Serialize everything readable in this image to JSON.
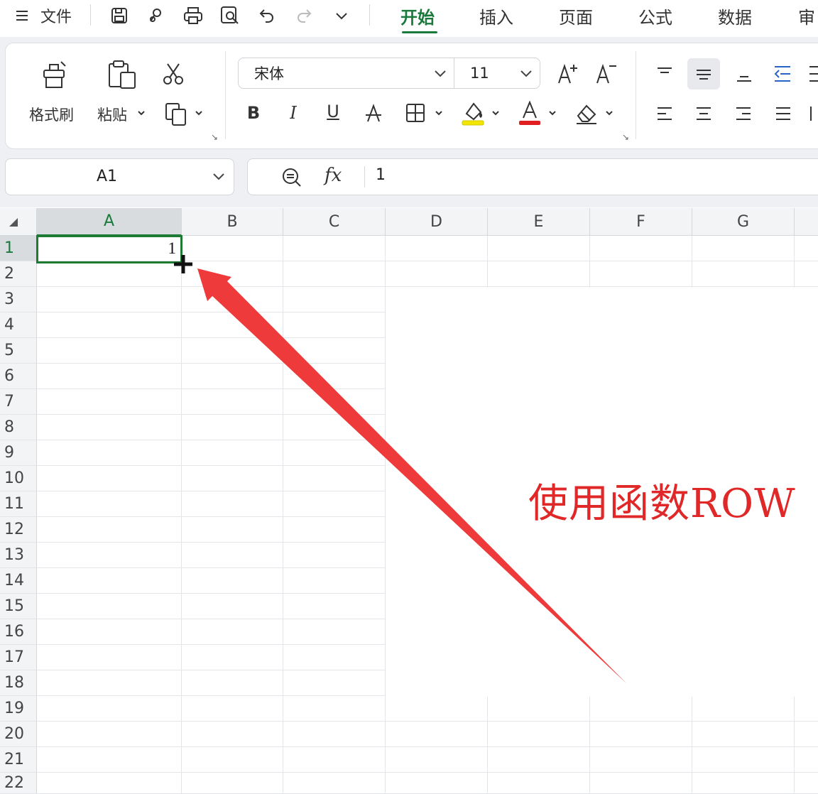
{
  "menu": {
    "file_label": "文件",
    "tabs": [
      "开始",
      "插入",
      "页面",
      "公式",
      "数据",
      "审"
    ]
  },
  "ribbon": {
    "format_painter_label": "格式刷",
    "paste_label": "粘贴",
    "font_name": "宋体",
    "font_size": "11",
    "bold_label": "B",
    "italic_label": "I",
    "underline_label": "U"
  },
  "formula_bar": {
    "name_box": "A1",
    "fx_label": "fx",
    "formula_value": "1"
  },
  "sheet": {
    "columns": [
      "A",
      "B",
      "C",
      "D",
      "E",
      "F",
      "G"
    ],
    "rows": [
      "1",
      "2",
      "3",
      "4",
      "5",
      "6",
      "7",
      "8",
      "9",
      "10",
      "11",
      "12",
      "13",
      "14",
      "15",
      "16",
      "17",
      "18",
      "19",
      "20",
      "21",
      "22"
    ],
    "active_cell": "A1",
    "cell_A1": "1"
  },
  "annotation": {
    "text": "使用函数ROW",
    "color": "#e02828"
  },
  "colors": {
    "accent_green": "#1a7a3c",
    "highlight_yellow": "#f2e600",
    "font_red": "#e02020"
  }
}
